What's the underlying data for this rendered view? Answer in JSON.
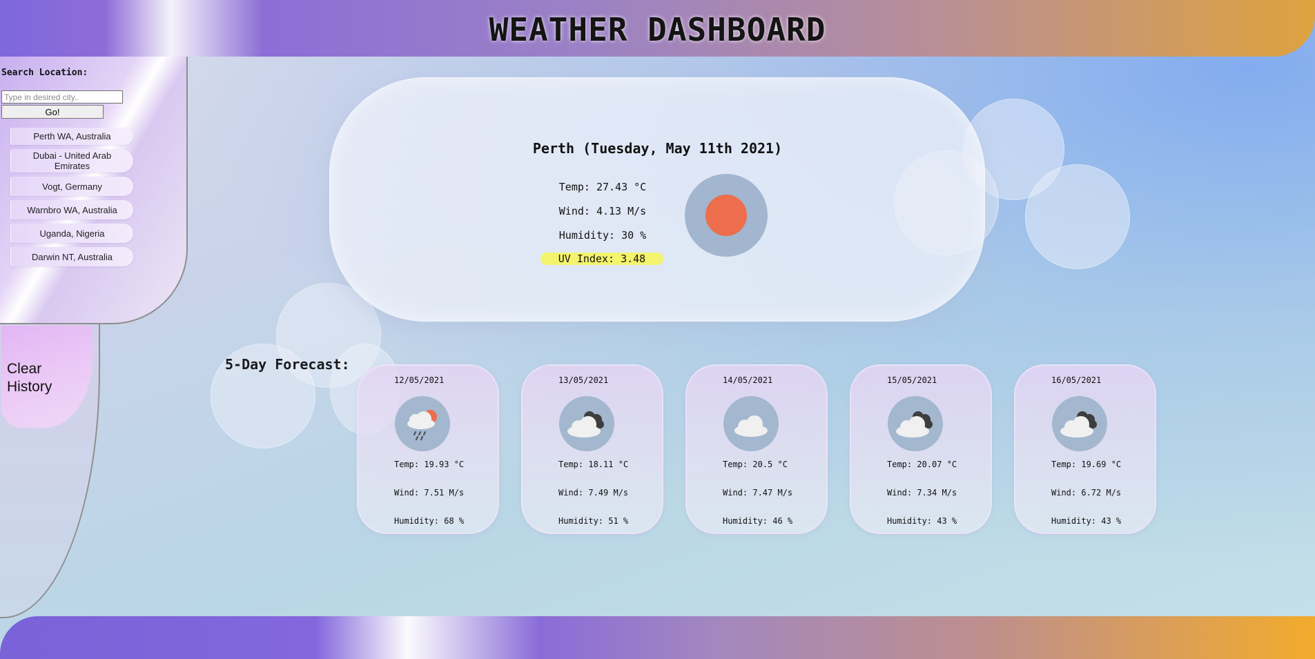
{
  "header": {
    "title": "WEATHER DASHBOARD"
  },
  "sidebar": {
    "search_label": "Search Location:",
    "search_placeholder": "Type in desired city..",
    "go_label": "Go!",
    "history": [
      "Perth WA, Australia",
      "Dubai - United Arab Emirates",
      "Vogt, Germany",
      "Warnbro WA, Australia",
      "Uganda, Nigeria",
      "Darwin NT, Australia"
    ],
    "clear_label_line1": "Clear",
    "clear_label_line2": "History"
  },
  "current": {
    "title": "Perth (Tuesday, May 11th 2021)",
    "temp": "Temp: 27.43 °C",
    "wind": "Wind: 4.13 M/s",
    "humidity": "Humidity: 30 %",
    "uv": "UV Index: 3.48",
    "icon": "sun-icon",
    "uv_color": "#f3f36d"
  },
  "forecast": {
    "title": "5-Day Forecast:",
    "days": [
      {
        "date": "12/05/2021",
        "icon": "rain-sun-cloud-icon",
        "temp": "Temp: 19.93 °C",
        "wind": "Wind: 7.51 M/s",
        "humidity": "Humidity: 68 %"
      },
      {
        "date": "13/05/2021",
        "icon": "broken-clouds-icon",
        "temp": "Temp: 18.11 °C",
        "wind": "Wind: 7.49 M/s",
        "humidity": "Humidity: 51 %"
      },
      {
        "date": "14/05/2021",
        "icon": "cloud-icon",
        "temp": "Temp: 20.5 °C",
        "wind": "Wind: 7.47 M/s",
        "humidity": "Humidity: 46 %"
      },
      {
        "date": "15/05/2021",
        "icon": "broken-clouds-icon",
        "temp": "Temp: 20.07 °C",
        "wind": "Wind: 7.34 M/s",
        "humidity": "Humidity: 43 %"
      },
      {
        "date": "16/05/2021",
        "icon": "broken-clouds-icon",
        "temp": "Temp: 19.69 °C",
        "wind": "Wind: 6.72 M/s",
        "humidity": "Humidity: 43 %"
      }
    ]
  }
}
